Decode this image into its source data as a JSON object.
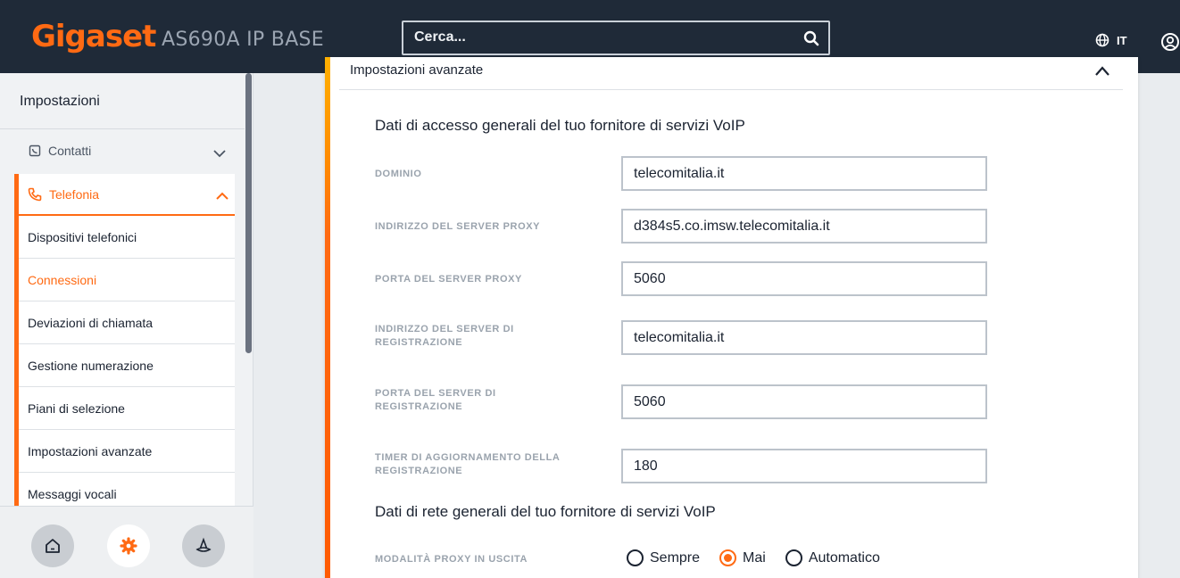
{
  "header": {
    "logo": "Gigaset",
    "model": "AS690A IP BASE",
    "search_placeholder": "Cerca...",
    "language": "IT"
  },
  "sidebar": {
    "title": "Impostazioni",
    "contatti": "Contatti",
    "telefonia": "Telefonia",
    "items": [
      {
        "label": "Dispositivi telefonici",
        "active": false
      },
      {
        "label": "Connessioni",
        "active": true
      },
      {
        "label": "Deviazioni di chiamata",
        "active": false
      },
      {
        "label": "Gestione numerazione",
        "active": false
      },
      {
        "label": "Piani di selezione",
        "active": false
      },
      {
        "label": "Impostazioni avanzate",
        "active": false
      },
      {
        "label": "Messaggi vocali",
        "active": false
      }
    ]
  },
  "panel": {
    "title": "Impostazioni avanzate",
    "section1": "Dati di accesso generali del tuo fornitore di servizi VoIP",
    "fields": [
      {
        "label": "Dominio",
        "value": "telecomitalia.it"
      },
      {
        "label": "Indirizzo del server proxy",
        "value": "d384s5.co.imsw.telecomitalia.it"
      },
      {
        "label": "Porta del server proxy",
        "value": "5060"
      },
      {
        "label": "Indirizzo del server di registrazione",
        "value": "telecomitalia.it"
      },
      {
        "label": "Porta del server di registrazione",
        "value": "5060"
      },
      {
        "label": "Timer di aggiornamento della registrazione",
        "value": "180"
      }
    ],
    "section2": "Dati di rete generali del tuo fornitore di servizi VoIP",
    "proxy_mode_label": "Modalità proxy in uscita",
    "proxy_mode_options": [
      "Sempre",
      "Mai",
      "Automatico"
    ],
    "proxy_mode_selected": "Mai"
  },
  "colors": {
    "accent": "#ff6a13",
    "header_bg": "#1f2a38"
  }
}
